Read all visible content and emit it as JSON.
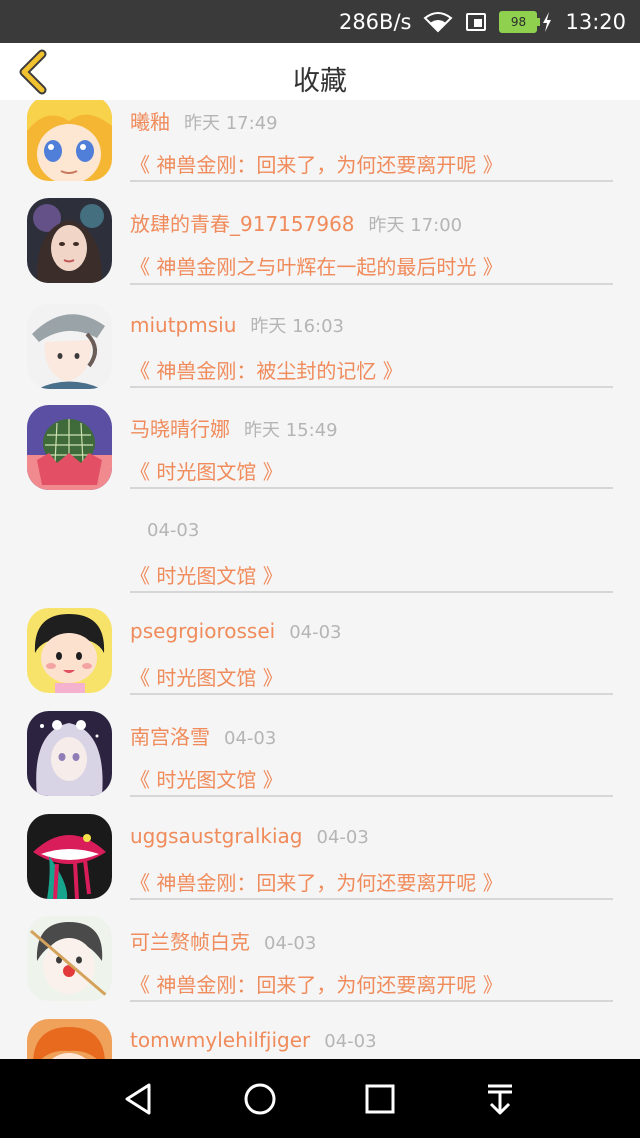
{
  "status_bar": {
    "speed": "286B/s",
    "battery": "98",
    "time": "13:20",
    "icons": [
      "wifi-icon",
      "sim-icon",
      "battery-icon",
      "charging-icon"
    ]
  },
  "header": {
    "title": "收藏",
    "back_icon": "chevron-left-icon",
    "accent_color": "#f2c12e"
  },
  "favorites": [
    {
      "user": "曦釉",
      "time": "昨天 17:49",
      "article": "《 神兽金刚：回来了，为何还要离开呢 》",
      "avatar": "blonde-anime-avatar"
    },
    {
      "user": "放肆的青春_917157968",
      "time": "昨天 17:00",
      "article": "《 神兽金刚之与叶辉在一起的最后时光 》",
      "avatar": "girl-portrait-avatar"
    },
    {
      "user": "miutpmsiu",
      "time": "昨天 16:03",
      "article": "《 神兽金刚：被尘封的记忆 》",
      "avatar": "boy-cap-avatar"
    },
    {
      "user": "马晓晴行娜",
      "time": "昨天 15:49",
      "article": "《 时光图文馆 》",
      "avatar": "cactus-avatar"
    },
    {
      "user": "",
      "time": "04-03",
      "article": "《 时光图文馆 》",
      "avatar": ""
    },
    {
      "user": "psegrgiorossei",
      "time": "04-03",
      "article": "《 时光图文馆 》",
      "avatar": "cartoon-girl-avatar"
    },
    {
      "user": "南宫洛雪",
      "time": "04-03",
      "article": "《 时光图文馆 》",
      "avatar": "white-hair-anime-avatar"
    },
    {
      "user": "uggsaustgralkiag",
      "time": "04-03",
      "article": "《 神兽金刚：回来了，为何还要离开呢 》",
      "avatar": "lips-avatar"
    },
    {
      "user": "可兰赘帧白克",
      "time": "04-03",
      "article": "《 神兽金刚：回来了，为何还要离开呢 》",
      "avatar": "clown-boy-avatar"
    },
    {
      "user": "tomwmylehilfjiger",
      "time": "04-03",
      "article": "",
      "avatar": "orange-hair-avatar"
    }
  ],
  "nav_bar": {
    "icons": [
      "back-triangle-icon",
      "home-circle-icon",
      "recents-square-icon",
      "notification-pull-icon"
    ]
  },
  "colors": {
    "link": "#f08b5b",
    "muted": "#b5b5b5",
    "background": "#f5f5f5",
    "status_bar": "#3a3a3a"
  }
}
